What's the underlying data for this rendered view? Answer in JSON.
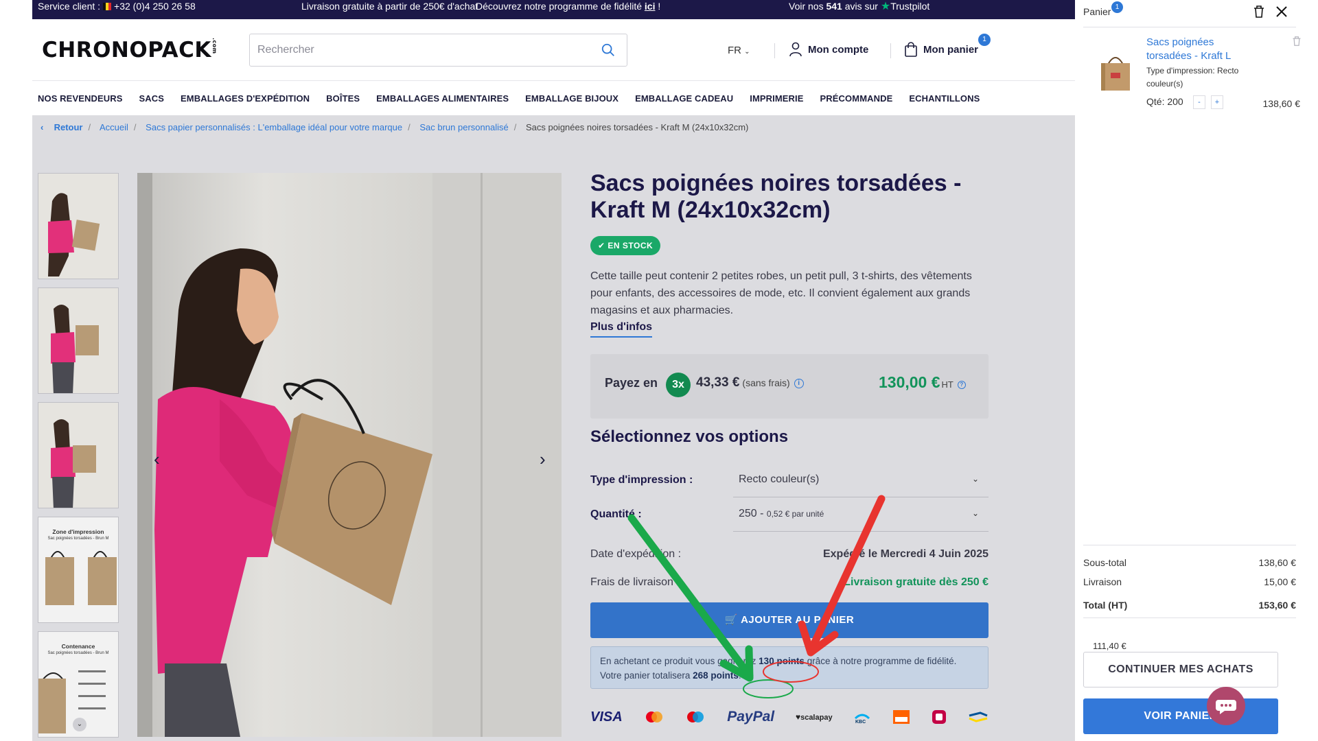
{
  "topbar": {
    "service_label": "Service client :",
    "phone": "+32 (0)4 250 26 58",
    "shipping": "Livraison gratuite à partir de 250€ d'achat",
    "loyalty_prefix": "Découvrez notre programme de fidélité",
    "loyalty_link": "ici",
    "loyalty_suffix": " !",
    "reviews_prefix": "Voir nos",
    "reviews_count": "541",
    "reviews_suffix": "avis sur",
    "trustpilot": "Trustpilot"
  },
  "header": {
    "logo": "CHRONOPACK",
    "logo_suffix": ".com",
    "search_placeholder": "Rechercher",
    "lang": "FR",
    "account": "Mon compte",
    "cart": "Mon panier",
    "cart_count": "1"
  },
  "nav": [
    "NOS REVENDEURS",
    "SACS",
    "EMBALLAGES D'EXPÉDITION",
    "BOÎTES",
    "EMBALLAGES ALIMENTAIRES",
    "EMBALLAGE BIJOUX",
    "EMBALLAGE CADEAU",
    "IMPRIMERIE",
    "PRÉCOMMANDE",
    "ECHANTILLONS"
  ],
  "breadcrumb": {
    "back": "Retour",
    "items": [
      "Accueil",
      "Sacs papier personnalisés : L'emballage idéal pour votre marque",
      "Sac brun personnalisé"
    ],
    "current": "Sacs poignées noires torsadées - Kraft M (24x10x32cm)"
  },
  "thumbs": {
    "zone_title": "Zone d'impression",
    "zone_sub": "Sac poignées torsadées - Brun M",
    "cont_title": "Contenance",
    "cont_sub": "Sac poignées torsadées - Brun M"
  },
  "product": {
    "title": "Sacs poignées noires torsadées - Kraft M (24x10x32cm)",
    "stock": "EN STOCK",
    "description": "Cette taille peut contenir 2 petites robes, un petit pull, 3 t-shirts, des vêtements pour enfants, des accessoires de mode, etc. Il convient également aux grands magasins et aux pharmacies.",
    "more": "Plus d'infos",
    "pay_label": "Payez en",
    "pay_times": "3x",
    "pay_amount": "43,33 €",
    "pay_fees": "(sans frais)",
    "price": "130,00 €",
    "price_unit": "HT",
    "options_title": "Sélectionnez vos options",
    "print_label": "Type d'impression :",
    "print_value": "Recto couleur(s)",
    "qty_label": "Quantité :",
    "qty_value": "250 -",
    "qty_unit_price": "0,52 € par unité",
    "ship_date_label": "Date d'expédition :",
    "ship_date_value": "Expédié le Mercredi 4 Juin 2025",
    "ship_fee_label": "Frais de livraison :",
    "ship_fee_value": "Livraison gratuite dès 250 €",
    "add_to_cart": "AJOUTER AU PANIER",
    "loyalty_text_1": "En achetant ce produit vous gagnerez",
    "loyalty_points": "130 points",
    "loyalty_text_2": "grâce à notre programme de fidélité. Votre panier totalisera",
    "loyalty_total": "268 points",
    "loyalty_end": "."
  },
  "payments": [
    "VISA",
    "Mastercard",
    "Maestro",
    "PayPal",
    "scalapay",
    "KBC",
    "ING",
    "Belfius",
    "Bancontact"
  ],
  "cart_panel": {
    "title": "Panier",
    "count": "1",
    "item_name": "Sacs poignées torsadées - Kraft L",
    "item_option": "Type d'impression: Recto couleur(s)",
    "item_qty_label": "Qté:",
    "item_qty": "200",
    "item_price": "138,60 €",
    "subtotal_label": "Sous-total",
    "subtotal": "138,60 €",
    "shipping_label": "Livraison",
    "shipping": "15,00 €",
    "total_label": "Total (HT)",
    "total": "153,60 €",
    "extra_amount": "111,40 €",
    "continue": "CONTINUER MES ACHATS",
    "view_cart": "VOIR PANIER"
  },
  "colors": {
    "navy": "#1c1848",
    "accent_blue": "#2e78d6",
    "stock_green": "#1aa868",
    "price_green": "#12935a",
    "annotation_green": "#1aa94a",
    "annotation_red": "#e8342f"
  }
}
